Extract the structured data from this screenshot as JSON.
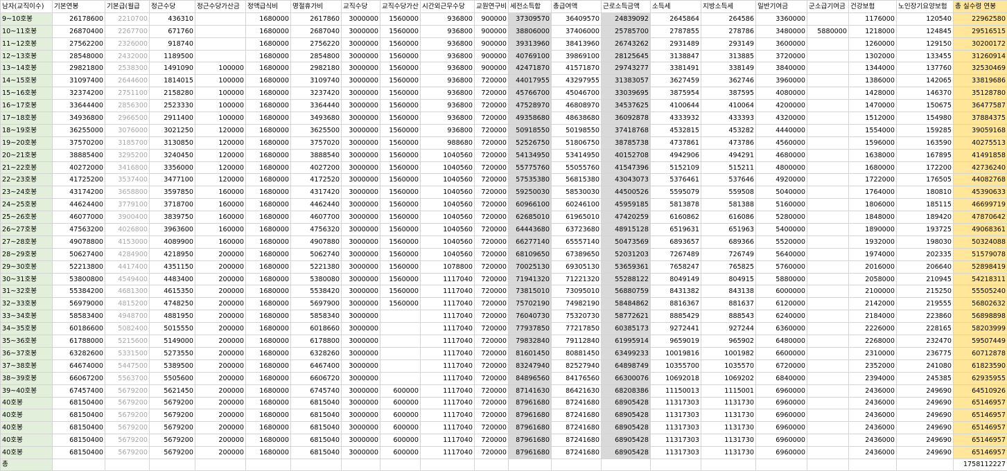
{
  "columns": [
    "남자(교직이수)",
    "기본연봉",
    "기본급(월급",
    "정근수당",
    "정근수당가산금",
    "정액급식비",
    "명절휴가비",
    "교직수당",
    "교직수당가산",
    "시간외근무수당",
    "교원연구비",
    "세전소득합",
    "총급여액",
    "근로소득금액",
    "소득세",
    "지방소득세",
    "일반기여금",
    "군소급기여금",
    "건강보험",
    "노인장기요양보험",
    "총 실수령 연봉"
  ],
  "rows": [
    [
      "9~10호봉",
      "26178600",
      "2210700",
      "436310",
      "",
      "1680000",
      "2617860",
      "3000000",
      "1560000",
      "936800",
      "900000",
      "37309570",
      "36409570",
      "24839092",
      "2645864",
      "264586",
      "3360000",
      "",
      "1176000",
      "120540",
      "22962580"
    ],
    [
      "10~11호봉",
      "26870400",
      "2267700",
      "671760",
      "",
      "1680000",
      "2687040",
      "3000000",
      "1560000",
      "936800",
      "900000",
      "38806000",
      "37406000",
      "25785700",
      "2787855",
      "278786",
      "3480000",
      "5880000",
      "1218000",
      "124845",
      "29516515"
    ],
    [
      "11~12호봉",
      "27562200",
      "2326000",
      "918740",
      "",
      "1680000",
      "2756220",
      "3000000",
      "1560000",
      "936800",
      "900000",
      "39313960",
      "38413960",
      "26743262",
      "2931489",
      "293149",
      "3600000",
      "",
      "1260000",
      "129150",
      "30200172"
    ],
    [
      "12~13호봉",
      "28548000",
      "2432000",
      "1189500",
      "",
      "1680000",
      "2854800",
      "3000000",
      "1560000",
      "936800",
      "900000",
      "40769100",
      "39869100",
      "28125645",
      "3138847",
      "313885",
      "3720000",
      "",
      "1302000",
      "133455",
      "31260914"
    ],
    [
      "13~14호봉",
      "29821800",
      "2538300",
      "1491090",
      "100000",
      "1680000",
      "2982180",
      "3000000",
      "1560000",
      "936800",
      "900000",
      "42471870",
      "41571870",
      "29743277",
      "3381491",
      "338149",
      "3840000",
      "",
      "1344000",
      "137760",
      "32530469"
    ],
    [
      "14~15호봉",
      "31097400",
      "2644600",
      "1814015",
      "100000",
      "1680000",
      "3109740",
      "3000000",
      "1560000",
      "936800",
      "720000",
      "44017955",
      "43297955",
      "31383057",
      "3627459",
      "362746",
      "3960000",
      "",
      "1386000",
      "142065",
      "33819686"
    ],
    [
      "15~16호봉",
      "32374200",
      "2751100",
      "2158280",
      "100000",
      "1680000",
      "3237420",
      "3000000",
      "1560000",
      "936800",
      "720000",
      "45766700",
      "45046700",
      "33039695",
      "3875954",
      "387595",
      "4080000",
      "",
      "1428000",
      "146370",
      "35128780"
    ],
    [
      "16~17호봉",
      "33644400",
      "2856300",
      "2523330",
      "100000",
      "1680000",
      "3364440",
      "3000000",
      "1560000",
      "936800",
      "720000",
      "47528970",
      "46808970",
      "34537625",
      "4100644",
      "410064",
      "4200000",
      "",
      "1470000",
      "150675",
      "36477587"
    ],
    [
      "17~18호봉",
      "34936800",
      "2966500",
      "2911400",
      "100000",
      "1680000",
      "3493680",
      "3000000",
      "1560000",
      "936800",
      "720000",
      "49358680",
      "48638680",
      "36092878",
      "4333932",
      "433393",
      "4320000",
      "",
      "1512000",
      "154980",
      "37884375"
    ],
    [
      "18~19호봉",
      "36255000",
      "3076000",
      "3021250",
      "120000",
      "1680000",
      "3625500",
      "3000000",
      "1560000",
      "936800",
      "720000",
      "50918550",
      "50198550",
      "37418768",
      "4532815",
      "453282",
      "4440000",
      "",
      "1554000",
      "159285",
      "39059168"
    ],
    [
      "19~20호봉",
      "37570200",
      "3185700",
      "3130850",
      "120000",
      "1680000",
      "3757020",
      "3000000",
      "1560000",
      "988680",
      "720000",
      "52526750",
      "51806750",
      "38785738",
      "4737861",
      "473786",
      "4560000",
      "",
      "1596000",
      "163590",
      "40275513"
    ],
    [
      "20~21호봉",
      "38885400",
      "3295200",
      "3240450",
      "120000",
      "1680000",
      "3888540",
      "3000000",
      "1560000",
      "1040560",
      "720000",
      "54134950",
      "53414950",
      "40152708",
      "4942906",
      "494291",
      "4680000",
      "",
      "1638000",
      "167895",
      "41491858"
    ],
    [
      "21~22호봉",
      "40272000",
      "3416800",
      "3356000",
      "120000",
      "1680000",
      "4027200",
      "3000000",
      "1560000",
      "1040560",
      "720000",
      "55775760",
      "55055760",
      "41547396",
      "5152109",
      "515211",
      "4800000",
      "",
      "1680000",
      "172200",
      "42736240"
    ],
    [
      "22~23호봉",
      "41725200",
      "3537400",
      "3477100",
      "120000",
      "1680000",
      "4172520",
      "3000000",
      "1560000",
      "1040560",
      "720000",
      "57535380",
      "56815380",
      "43043073",
      "5376461",
      "537646",
      "4920000",
      "",
      "1722000",
      "176505",
      "44082768"
    ],
    [
      "23~24호봉",
      "43174200",
      "3658800",
      "3597850",
      "160000",
      "1680000",
      "4317420",
      "3000000",
      "1560000",
      "1040560",
      "720000",
      "59250030",
      "58530030",
      "44500526",
      "5595079",
      "559508",
      "5040000",
      "",
      "1764000",
      "180810",
      "45390633"
    ],
    [
      "24~25호봉",
      "44624400",
      "3779100",
      "3718700",
      "160000",
      "1680000",
      "4462440",
      "3000000",
      "1560000",
      "1040560",
      "720000",
      "60966100",
      "60246100",
      "45959185",
      "5813878",
      "581388",
      "5160000",
      "",
      "1806000",
      "185115",
      "46699719"
    ],
    [
      "25~26호봉",
      "46077000",
      "3900400",
      "3839750",
      "160000",
      "1680000",
      "4607700",
      "3000000",
      "1560000",
      "1040560",
      "720000",
      "62685010",
      "61965010",
      "47420259",
      "6160862",
      "616086",
      "5280000",
      "",
      "1848000",
      "189420",
      "47870642"
    ],
    [
      "26~27호봉",
      "47563200",
      "4026800",
      "3963600",
      "160000",
      "1680000",
      "4756320",
      "3000000",
      "1560000",
      "1040560",
      "720000",
      "64443680",
      "63723680",
      "48915128",
      "6519631",
      "651963",
      "5400000",
      "",
      "1890000",
      "193725",
      "49068361"
    ],
    [
      "27~28호봉",
      "49078800",
      "4153000",
      "4089900",
      "160000",
      "1680000",
      "4907880",
      "3000000",
      "1560000",
      "1040560",
      "720000",
      "66277140",
      "65557140",
      "50473569",
      "6893657",
      "689366",
      "5520000",
      "",
      "1932000",
      "198030",
      "50324088"
    ],
    [
      "28~29호봉",
      "50627400",
      "4284900",
      "4218950",
      "200000",
      "1680000",
      "5062740",
      "3000000",
      "1560000",
      "1040560",
      "720000",
      "68109650",
      "67389650",
      "52031203",
      "7267489",
      "726749",
      "5640000",
      "",
      "1974000",
      "202335",
      "51579078"
    ],
    [
      "29~30호봉",
      "52213800",
      "4417400",
      "4351150",
      "200000",
      "1680000",
      "5221380",
      "3000000",
      "1560000",
      "1078800",
      "720000",
      "70025130",
      "69305130",
      "53659361",
      "7658247",
      "765825",
      "5760000",
      "",
      "2016000",
      "206640",
      "52898419"
    ],
    [
      "30~31호봉",
      "53800800",
      "4549400",
      "4483400",
      "200000",
      "1680000",
      "5380080",
      "3000000",
      "1560000",
      "1117040",
      "720000",
      "71941320",
      "71221320",
      "55288122",
      "8049149",
      "804915",
      "5880000",
      "",
      "2058000",
      "210945",
      "54218311"
    ],
    [
      "31~32호봉",
      "55384200",
      "4681300",
      "4615350",
      "200000",
      "1680000",
      "5538420",
      "3000000",
      "1560000",
      "1117040",
      "720000",
      "73815010",
      "73095010",
      "56880759",
      "8431382",
      "843138",
      "6000000",
      "",
      "2100000",
      "215250",
      "55505240"
    ],
    [
      "32~33호봉",
      "56979000",
      "4815200",
      "4748250",
      "200000",
      "1680000",
      "5697900",
      "3000000",
      "1560000",
      "1117040",
      "720000",
      "75702190",
      "74982190",
      "58484862",
      "8816367",
      "881637",
      "6120000",
      "",
      "2142000",
      "219555",
      "56802632"
    ],
    [
      "33~34호봉",
      "58583400",
      "4948700",
      "4881950",
      "200000",
      "1680000",
      "5858340",
      "3000000",
      "",
      "1117040",
      "720000",
      "76040730",
      "75320730",
      "58772621",
      "8885429",
      "888543",
      "6240000",
      "",
      "2184000",
      "223860",
      "56898898"
    ],
    [
      "34~35호봉",
      "60186600",
      "5082400",
      "5015550",
      "200000",
      "1680000",
      "6018660",
      "3000000",
      "",
      "1117040",
      "720000",
      "77937850",
      "77217850",
      "60385173",
      "9272441",
      "927244",
      "6360000",
      "",
      "2226000",
      "228165",
      "58203999"
    ],
    [
      "35~36호봉",
      "61788000",
      "5215600",
      "5149000",
      "200000",
      "1680000",
      "6178800",
      "3000000",
      "",
      "1117040",
      "720000",
      "79832840",
      "79112840",
      "61995914",
      "9659019",
      "965902",
      "6480000",
      "",
      "2268000",
      "232470",
      "59507449"
    ],
    [
      "36~37호봉",
      "63282600",
      "5331500",
      "5273550",
      "200000",
      "1680000",
      "6328260",
      "3000000",
      "",
      "1117040",
      "720000",
      "81601450",
      "80881450",
      "63499233",
      "10019816",
      "1001982",
      "6600000",
      "",
      "2310000",
      "236775",
      "60712878"
    ],
    [
      "37~38호봉",
      "64674000",
      "5447500",
      "5389500",
      "200000",
      "1680000",
      "6467400",
      "3000000",
      "",
      "1117040",
      "720000",
      "83247940",
      "82527940",
      "64898749",
      "10355700",
      "1035570",
      "6720000",
      "",
      "2352000",
      "241080",
      "61823590"
    ],
    [
      "38~39호봉",
      "66067200",
      "5563700",
      "5505600",
      "200000",
      "1680000",
      "6606720",
      "3000000",
      "",
      "1117040",
      "720000",
      "84896560",
      "84176560",
      "66300076",
      "10692018",
      "1069202",
      "6840000",
      "",
      "2394000",
      "245385",
      "62935955"
    ],
    [
      "39~40호봉",
      "67457400",
      "5679200",
      "5621450",
      "200000",
      "1680000",
      "6745740",
      "3000000",
      "600000",
      "1117040",
      "720000",
      "87141630",
      "86421630",
      "68208386",
      "11150013",
      "1115001",
      "6960000",
      "",
      "2436000",
      "249690",
      "64510926"
    ],
    [
      "40호봉",
      "68150400",
      "5679200",
      "5679200",
      "200000",
      "1680000",
      "6815040",
      "3000000",
      "600000",
      "1117040",
      "720000",
      "87961680",
      "87241680",
      "68905428",
      "11317303",
      "1131730",
      "6960000",
      "",
      "2436000",
      "249690",
      "65146957"
    ],
    [
      "40호봉",
      "68150400",
      "5679200",
      "5679200",
      "200000",
      "1680000",
      "6815040",
      "3000000",
      "600000",
      "1117040",
      "720000",
      "87961680",
      "87241680",
      "68905428",
      "11317303",
      "1131730",
      "6960000",
      "",
      "2436000",
      "249690",
      "65146957"
    ],
    [
      "40호봉",
      "68150400",
      "5679200",
      "5679200",
      "200000",
      "1680000",
      "6815040",
      "3000000",
      "600000",
      "1117040",
      "720000",
      "87961680",
      "87241680",
      "68905428",
      "11317303",
      "1131730",
      "6960000",
      "",
      "2436000",
      "249690",
      "65146957"
    ],
    [
      "40호봉",
      "68150400",
      "5679200",
      "5679200",
      "200000",
      "1680000",
      "6815040",
      "3000000",
      "600000",
      "1117040",
      "720000",
      "87961680",
      "87241680",
      "68905428",
      "11317303",
      "1131730",
      "6960000",
      "",
      "2436000",
      "249690",
      "65146957"
    ],
    [
      "40호봉",
      "68150400",
      "5679200",
      "5679200",
      "200000",
      "1680000",
      "6815040",
      "3000000",
      "600000",
      "1117040",
      "720000",
      "87961680",
      "87241680",
      "68905428",
      "11317303",
      "1131730",
      "6960000",
      "",
      "2436000",
      "249690",
      "65146957"
    ]
  ],
  "total": {
    "label": "총",
    "value": "1758112227"
  },
  "colors": {
    "label_bg": "#e2efda",
    "shade_bg": "#d9d9d9",
    "highlight_bg": "#ffe699",
    "muted_text": "#a6a6a6"
  }
}
